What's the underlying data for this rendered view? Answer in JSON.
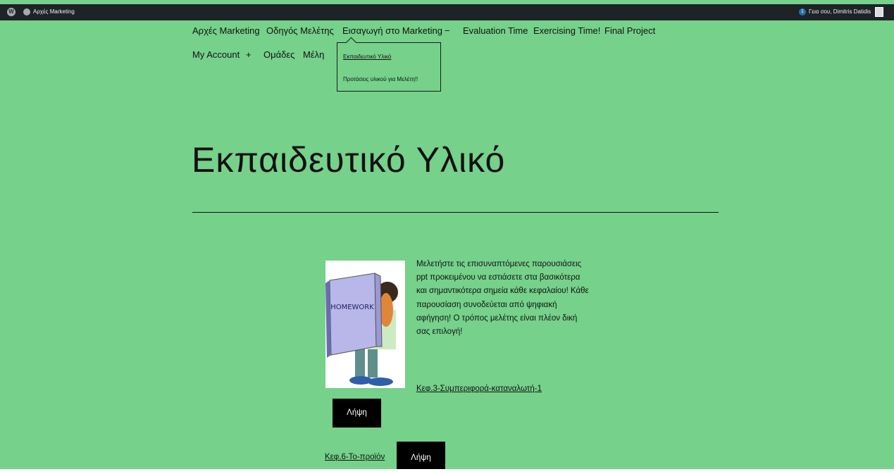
{
  "admin_bar": {
    "site_name": "Αρχές Marketing",
    "notification_count": "1",
    "greeting": "Γεια σου, Dimitris Datidis"
  },
  "nav": {
    "items": [
      "Αρχές Marketing",
      "Οδηγός Μελέτης",
      "Εισαγωγή στο Marketing",
      "−",
      "Evaluation Time",
      "Exercising Time!",
      "Final Project",
      "My Account",
      "+",
      "Ομάδες",
      "Μέλη"
    ],
    "submenu": [
      "Εκπαιδευτικό Υλικό",
      "Προτάσεις υλικού για Μελέτη!!"
    ]
  },
  "page": {
    "title": "Εκπαιδευτικό Υλικό",
    "image_label": "HOMEWORK",
    "paragraph": "Μελετήστε τις επισυναπτόμενες παρουσιάσεις ppt προκειμένου να εστιάσετε στα βασικότερα και σημαντικότερα σημεία κάθε κεφαλαίου! Κάθε παρουσίαση συνοδεύεται από ψηφιακή αφήγηση! Ο τρόπος μελέτης είναι πλέον δική σας επιλογή!",
    "file1_link": "Κεφ.3-Συμπεριφορά-καταναλωτή-1",
    "file1_download": "Λήψη",
    "file2_link": "Κεφ.6-Το-προϊόν",
    "file2_download": "Λήψη"
  },
  "colors": {
    "background": "#76d18b",
    "admin_bar": "#1d2327",
    "button": "#000000"
  }
}
